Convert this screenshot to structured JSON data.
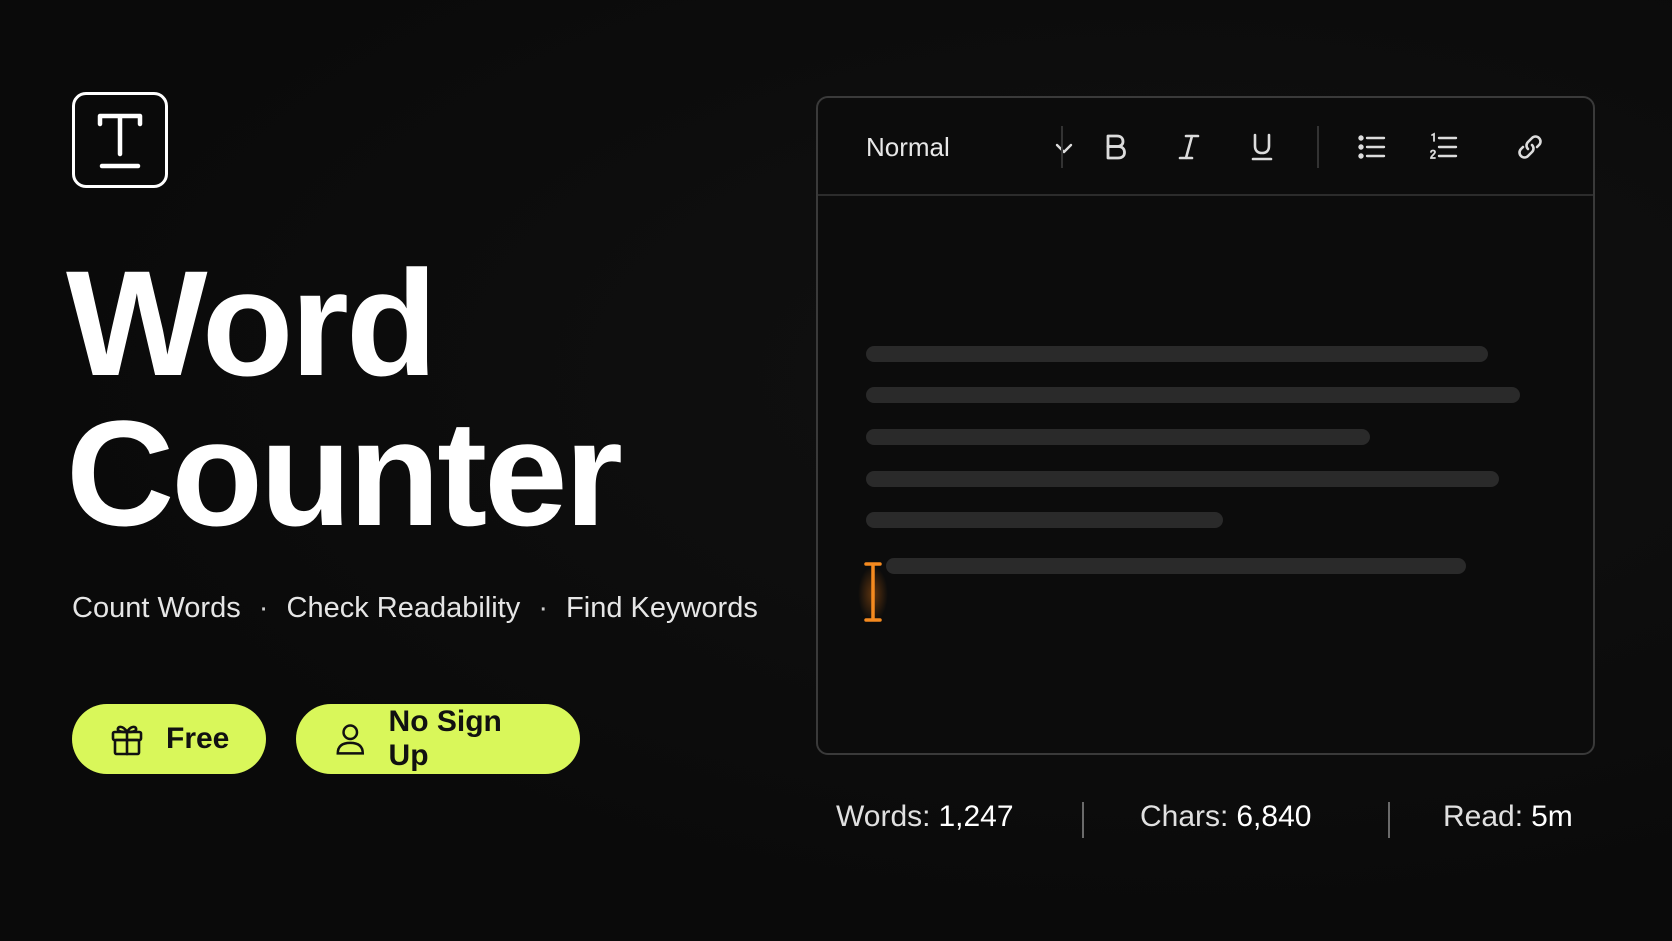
{
  "hero": {
    "logo_icon": "text-t-icon",
    "title_line1": "Word",
    "title_line2": "Counter",
    "features": [
      "Count Words",
      "Check Readability",
      "Find Keywords"
    ],
    "feature_separator": "·",
    "badges": [
      {
        "label": "Free",
        "icon": "gift-icon"
      },
      {
        "label": "No Sign Up",
        "icon": "user-icon"
      }
    ],
    "accent_color": "#d9f75a"
  },
  "editor": {
    "style_select": "Normal",
    "toolbar": {
      "bold": "B",
      "italic": "I",
      "underline": "U",
      "bullets_icon": "bulleted-list-icon",
      "numbers_icon": "numbered-list-icon",
      "link_icon": "link-icon"
    },
    "caret_color": "#f58a1f"
  },
  "stats": {
    "words_label": "Words:",
    "words_value": "1,247",
    "chars_label": "Chars:",
    "chars_value": "6,840",
    "read_label": "Read:",
    "read_value": "5m"
  }
}
